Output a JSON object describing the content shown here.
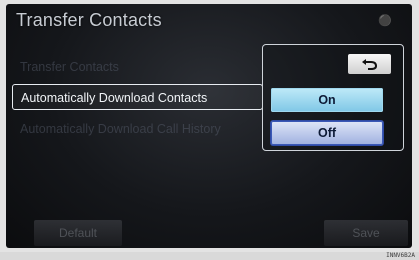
{
  "header": {
    "title": "Transfer Contacts"
  },
  "rows": [
    {
      "label": "Transfer Contacts"
    },
    {
      "label": "Automatically Download Contacts"
    },
    {
      "label": "Automatically Download Call History"
    }
  ],
  "options": {
    "on_label": "On",
    "off_label": "Off",
    "selected": "Off"
  },
  "footer": {
    "default_label": "Default",
    "save_label": "Save"
  },
  "watermark": "INNV6B2A",
  "icons": {
    "back": "return-arrow-icon"
  }
}
